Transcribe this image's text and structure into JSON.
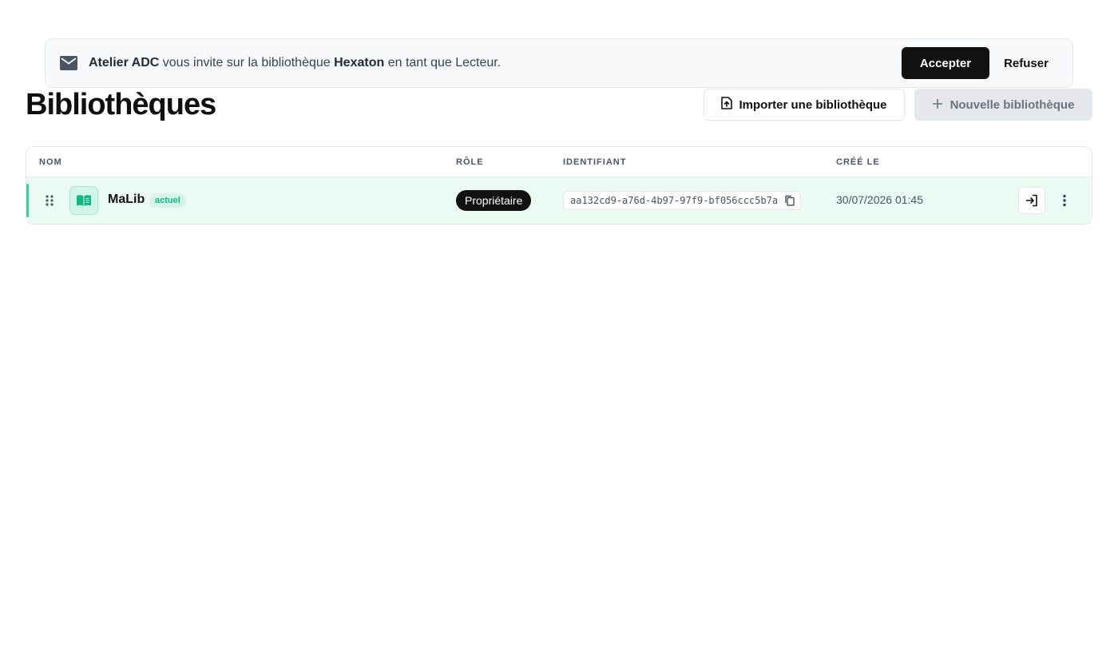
{
  "invitation": {
    "icon": "mail-icon",
    "inviter": "Atelier ADC",
    "text_middle": "vous invite sur la bibliothèque",
    "library": "Hexaton",
    "text_end": "en tant que Lecteur.",
    "accept_label": "Accepter",
    "refuse_label": "Refuser"
  },
  "page": {
    "title": "Bibliothèques",
    "import_label": "Importer une bibliothèque",
    "new_label": "Nouvelle bibliothèque"
  },
  "table": {
    "columns": {
      "name": "NOM",
      "role": "RÔLE",
      "identifier": "IDENTIFIANT",
      "created": "CRÉÉ LE"
    },
    "rows": [
      {
        "name": "MaLib",
        "badge": "actuel",
        "role": "Propriétaire",
        "identifier": "aa132cd9-a76d-4b97-97f9-bf056ccc5b7a",
        "created": "30/07/2026 01:45"
      }
    ]
  },
  "colors": {
    "accent": "#34d399",
    "row_bg": "#ecfaf4",
    "primary_button": "#111111"
  }
}
